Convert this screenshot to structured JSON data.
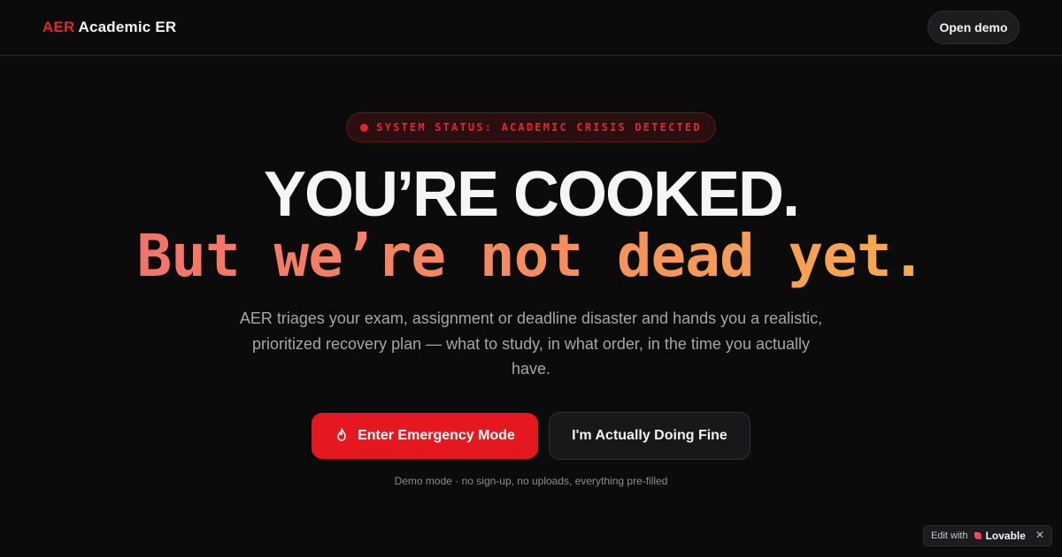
{
  "header": {
    "brand_abbr": "AER",
    "brand_name": "Academic ER",
    "open_demo_label": "Open demo"
  },
  "status": {
    "text": "SYSTEM STATUS: ACADEMIC CRISIS DETECTED"
  },
  "hero": {
    "headline_line1": "YOU’RE COOKED.",
    "headline_line2": "But we’re not dead yet.",
    "description": "AER triages your exam, assignment or deadline disaster and hands you a realistic, prioritized recovery plan — what to study, in what order, in the time you actually have."
  },
  "actions": {
    "primary_label": "Enter Emergency Mode",
    "primary_icon": "flame-icon",
    "secondary_label": "I'm Actually Doing Fine"
  },
  "note": "Demo mode · no sign-up, no uploads, everything pre-filled",
  "badge": {
    "prefix": "Edit with",
    "logo_text": "Lovable",
    "close_symbol": "✕"
  },
  "colors": {
    "background": "#0b0b0c",
    "accent_red": "#e5171f",
    "gradient_start": "#f3736a",
    "gradient_end": "#f8aa4a"
  }
}
